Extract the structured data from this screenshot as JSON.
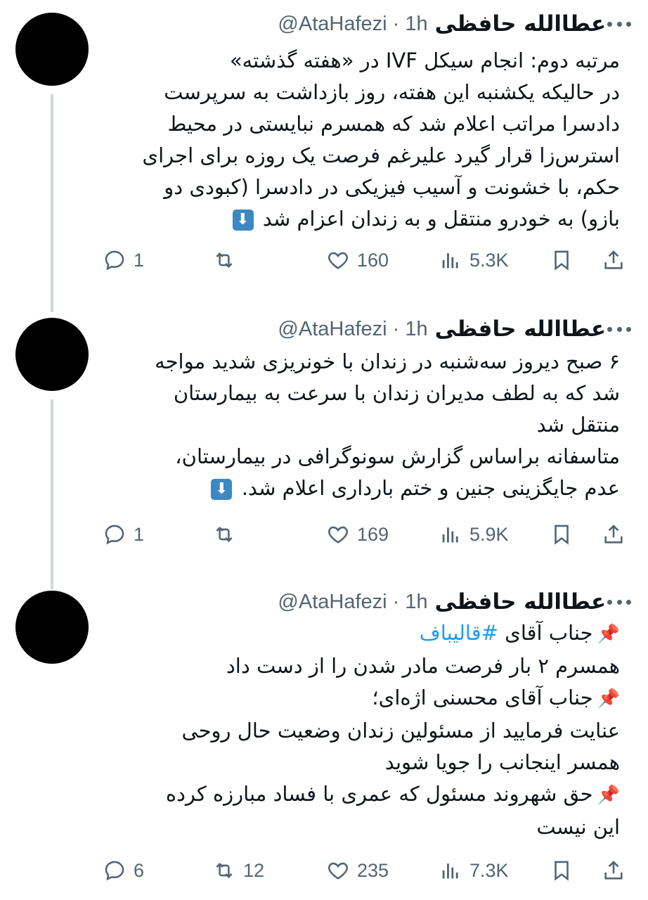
{
  "tweets": [
    {
      "author": "عطاالله حافظی",
      "handle": "@AtaHafezi",
      "time": "1h",
      "lines": [
        "مرتبه دوم: انجام سیکل IVF در «هفته گذشته»",
        "در حالیکه یکشنبه این هفته، روز بازداشت به سرپرست",
        "دادسرا مراتب اعلام شد که همسرم نبایستی در محیط",
        "استرس‌زا قرار گیرد علیرغم فرصت یک روزه برای اجرای",
        "حکم، با خشونت و آسیب فیزیکی در دادسرا (کبودی دو",
        "بازو) به خودرو منتقل و به زندان اعزام شد"
      ],
      "replies": "1",
      "retweets": "",
      "likes": "160",
      "views": "5.3K"
    },
    {
      "author": "عطاالله حافظی",
      "handle": "@AtaHafezi",
      "time": "1h",
      "lines": [
        "۶ صبح دیروز سه‌شنبه در زندان با خونریزی شدید مواجه",
        "شد که به لطف مدیران زندان با سرعت به بیمارستان",
        "منتقل شد",
        "متاسفانه براساس گزارش سونوگرافی در بیمارستان،",
        "عدم جایگزینی جنین و ختم بارداری اعلام شد."
      ],
      "replies": "1",
      "retweets": "",
      "likes": "169",
      "views": "5.9K"
    },
    {
      "author": "عطاالله حافظی",
      "handle": "@AtaHafezi",
      "time": "1h",
      "lines": [
        "جناب آقای",
        "#قالیباف",
        "همسرم ۲ بار فرصت مادر شدن را از دست داد",
        "جناب آقای محسنی اژه‌ای؛",
        "عنایت فرمایید از مسئولین زندان وضعیت حال روحی",
        "همسر اینجانب را جویا شوید",
        "حق شهروند مسئول که عمری با فساد مبارزه کرده",
        "این نیست"
      ],
      "replies": "6",
      "retweets": "12",
      "likes": "235",
      "views": "7.3K"
    }
  ],
  "icons": {
    "reply": "reply-icon",
    "retweet": "retweet-icon",
    "like": "heart-icon",
    "views": "views-icon",
    "bookmark": "bookmark-icon",
    "share": "share-icon",
    "more": "more-icon",
    "down_arrow": "down-arrow-emoji",
    "pin": "pushpin-emoji"
  },
  "colors": {
    "text": "#0f1419",
    "muted": "#536471",
    "link": "#1d9bf0",
    "thread": "#cfd9de"
  }
}
